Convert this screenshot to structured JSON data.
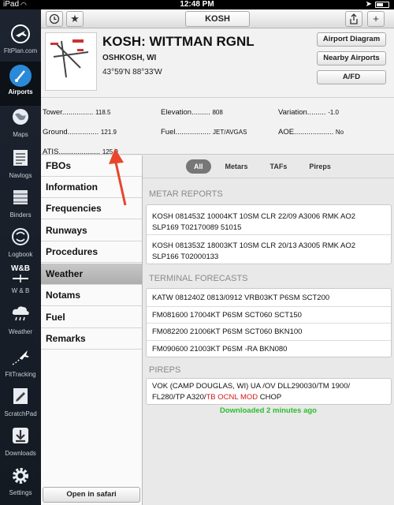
{
  "status_bar": {
    "carrier": "iPad",
    "time": "12:48 PM"
  },
  "dock": {
    "items": [
      {
        "label": "FltPlan.com",
        "icon": "airplane-icon"
      },
      {
        "label": "Airports",
        "icon": "compass-icon",
        "active": true
      },
      {
        "label": "Maps",
        "icon": "globe-icon"
      },
      {
        "label": "Navlogs",
        "icon": "navlog-icon"
      },
      {
        "label": "Binders",
        "icon": "binder-icon"
      },
      {
        "label": "Logbook",
        "icon": "logbook-icon"
      },
      {
        "label": "W & B",
        "icon": "weight-balance-icon",
        "badge": "W&B"
      },
      {
        "label": "Weather",
        "icon": "cloud-rain-icon"
      },
      {
        "label": "FltTracking",
        "icon": "tracking-icon"
      },
      {
        "label": "ScratchPad",
        "icon": "scratchpad-icon"
      },
      {
        "label": "Downloads",
        "icon": "download-icon"
      },
      {
        "label": "Settings",
        "icon": "gear-icon"
      }
    ]
  },
  "toolbar": {
    "search_value": "KOSH",
    "plus_label": "+"
  },
  "airport": {
    "name": "KOSH: WITTMAN RGNL",
    "city": "OSHKOSH, WI",
    "coords": "43°59'N  88°33'W",
    "buttons": {
      "diagram": "Airport Diagram",
      "nearby": "Nearby Airports",
      "afd": "A/FD"
    }
  },
  "frequencies": {
    "tower": {
      "label": "Tower...............",
      "value": "118.5"
    },
    "ground": {
      "label": "Ground...............",
      "value": "121.9"
    },
    "atis": {
      "label": "ATIS....................",
      "value": "125.9"
    },
    "elevation": {
      "label": "Elevation.........",
      "value": "808"
    },
    "fuel": {
      "label": "Fuel.................",
      "value": "JET/AVGAS"
    },
    "variation": {
      "label": "Variation.........",
      "value": "-1.0"
    },
    "aoe": {
      "label": "AOE...................",
      "value": "No"
    }
  },
  "categories": [
    "FBOs",
    "Information",
    "Frequencies",
    "Runways",
    "Procedures",
    "Weather",
    "Notams",
    "Fuel",
    "Remarks"
  ],
  "selected_category": "Weather",
  "open_in_safari": "Open in safari",
  "weather": {
    "tabs": [
      "All",
      "Metars",
      "TAFs",
      "Pireps"
    ],
    "selected_tab": "All",
    "metar_title": "METAR REPORTS",
    "metars": [
      [
        "KOSH 081453Z 10004KT 10SM CLR 22/09 A3006 RMK AO2",
        "SLP169 T02170089 51015"
      ],
      [
        "KOSH 081353Z 18003KT 10SM CLR 20/13 A3005 RMK AO2",
        "SLP166 T02000133"
      ]
    ],
    "taf_title": "TERMINAL FORECASTS",
    "tafs": [
      "KATW 081240Z 0813/0912 VRB03KT P6SM SCT200",
      "FM081600 17004KT P6SM SCT060 SCT150",
      "FM082200 21006KT P6SM SCT060 BKN100",
      "FM090600 21003KT P6SM -RA BKN080"
    ],
    "pirep_title": "PIREPS",
    "pirep": {
      "line1": "VOK (CAMP DOUGLAS, WI) UA /OV DLL290030/TM 1900/",
      "line2_pre": "FL280/TP A320/",
      "line2_hl": "TB OCNL MOD",
      "line2_post": " CHOP"
    },
    "downloaded": "Downloaded 2 minutes ago"
  },
  "colors": {
    "accent": "#2a8ad8",
    "downloaded": "#2bbd2b",
    "highlight": "#d21a1a",
    "annotation_arrow": "#e8452c"
  }
}
